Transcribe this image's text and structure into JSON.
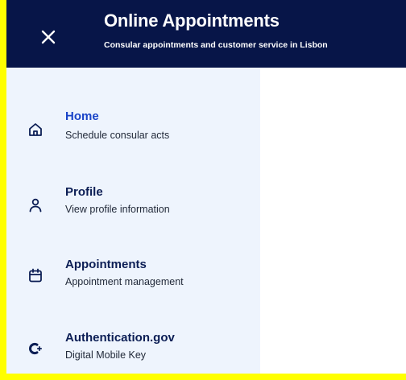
{
  "header": {
    "title": "Online Appointments",
    "subtitle": "Consular appointments and customer service in Lisbon",
    "close_icon": "close-icon"
  },
  "colors": {
    "header_bg": "#071548",
    "sidebar_bg": "#eef4fd",
    "active_label": "#1a44c8",
    "label": "#0c1e55",
    "frame": "#ffff00"
  },
  "nav": {
    "items": [
      {
        "label": "Home",
        "description": "Schedule consular acts",
        "icon": "home-icon",
        "active": true
      },
      {
        "label": "Profile",
        "description": "View profile information",
        "icon": "user-icon",
        "active": false
      },
      {
        "label": "Appointments",
        "description": "Appointment management",
        "icon": "calendar-icon",
        "active": false
      },
      {
        "label": "Authentication.gov",
        "description": "Digital Mobile Key",
        "icon": "key-icon",
        "active": false
      }
    ]
  }
}
